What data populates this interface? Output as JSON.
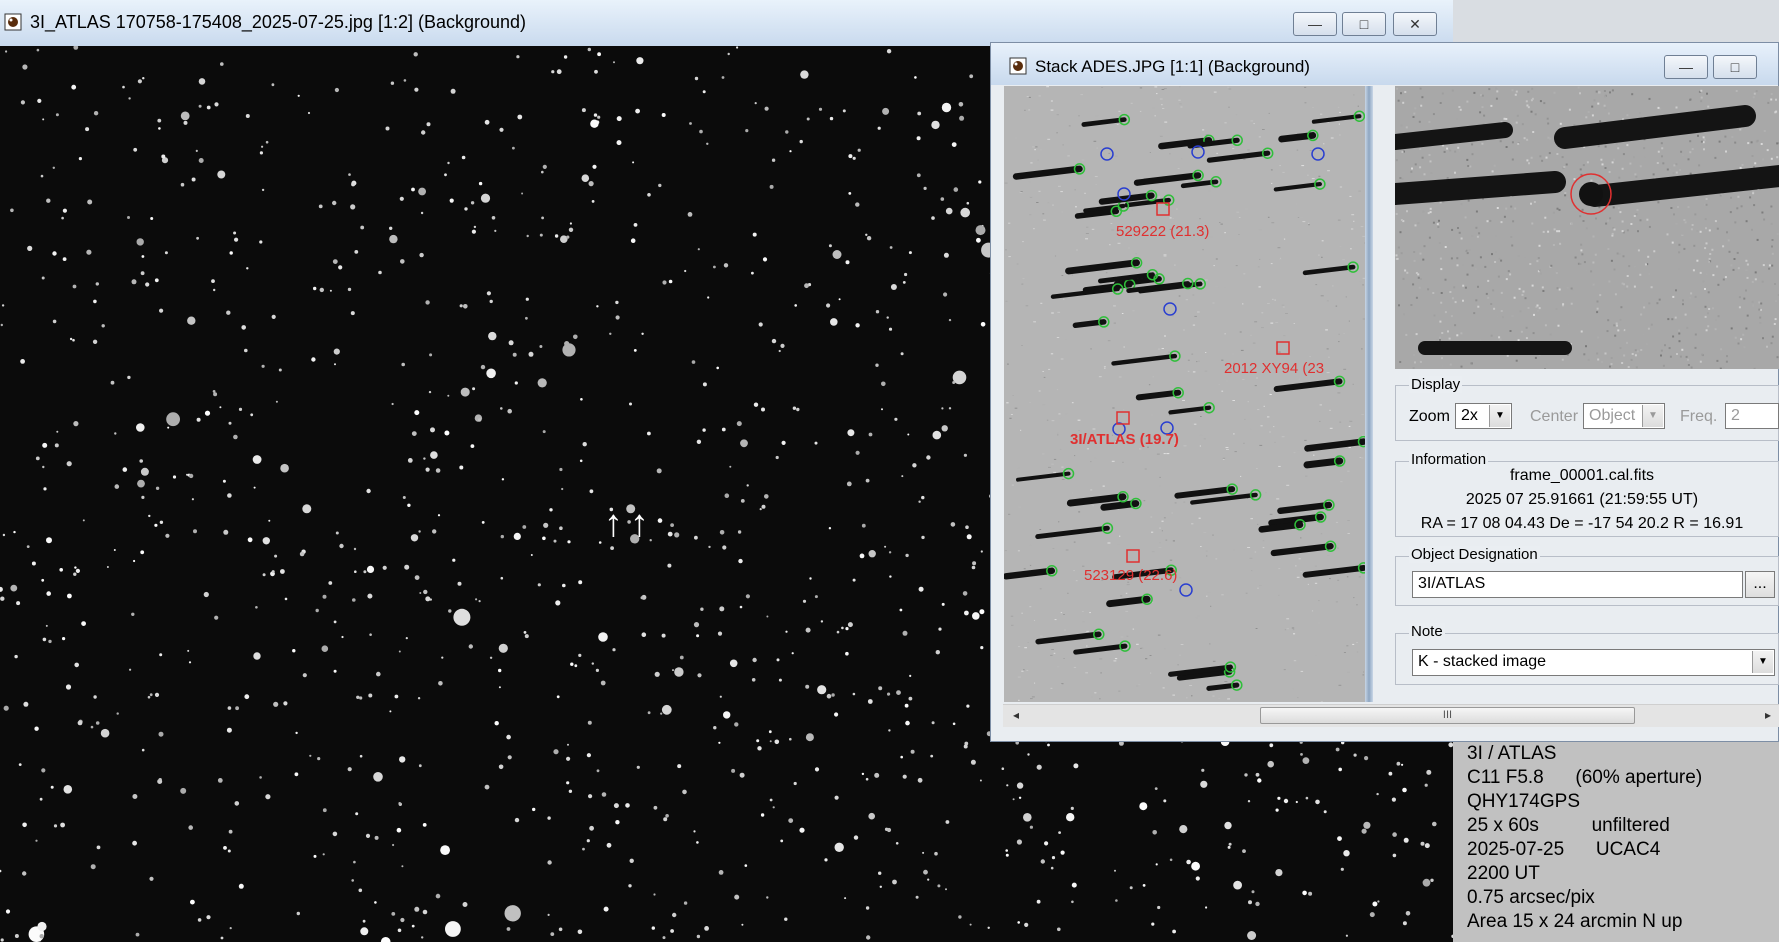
{
  "main_window": {
    "title": "3I_ATLAS 170758-175408_2025-07-25.jpg [1:2] (Background)",
    "minimize_glyph": "—",
    "maximize_glyph": "□",
    "close_glyph": "✕",
    "arrow_glyph": "↑"
  },
  "stack_window": {
    "title": "Stack ADES.JPG [1:1] (Background)",
    "image_labels": [
      "529222 (21.3)",
      "2012 XY94 (23",
      "3I/ATLAS (19.7)",
      "523129 (22.6)"
    ],
    "display": {
      "legend": "Display",
      "zoom_label": "Zoom",
      "zoom_value": "2x",
      "center_label": "Center",
      "center_value": "Object",
      "freq_label": "Freq.",
      "freq_value": "2"
    },
    "information": {
      "legend": "Information",
      "file": "frame_00001.cal.fits",
      "date": "2025 07 25.91661 (21:59:55 UT)",
      "coords": "RA = 17 08 04.43   De = -17 54 20.2   R  = 16.91"
    },
    "object_designation": {
      "legend": "Object Designation",
      "value": "3I/ATLAS",
      "browse_label": "..."
    },
    "note": {
      "legend": "Note",
      "value": "K - stacked image"
    },
    "scroll_grip": "III",
    "scroll_left": "◂",
    "scroll_right": "▸"
  },
  "side_notes": [
    "3I / ATLAS",
    "C11 F5.8      (60% aperture)",
    "QHY174GPS",
    "25 x 60s          unfiltered",
    "2025-07-25      UCAC4",
    "2200 UT",
    "0.75 arcsec/pix",
    "Area 15 x 24 arcmin N up"
  ],
  "colors": {
    "label_red": "#e03030",
    "marker_green": "#2fbf3a",
    "marker_blue": "#2a3fd0",
    "title_bar": "#d3e2f3"
  }
}
